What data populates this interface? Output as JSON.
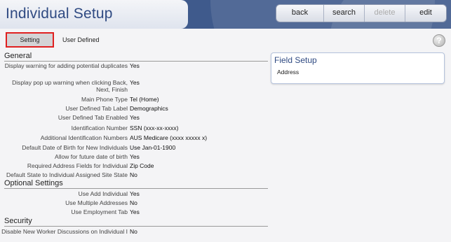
{
  "page": {
    "title": "Individual Setup"
  },
  "toolbar": {
    "back": "back",
    "search": "search",
    "delete": "delete",
    "edit": "edit"
  },
  "tabs": {
    "setting": "Setting",
    "user_defined": "User Defined"
  },
  "help_icon": "question-mark-icon",
  "general": {
    "heading": "General",
    "rows": [
      {
        "label": "Display warning for adding potential duplicates",
        "value": "Yes"
      },
      {
        "label": "Display pop up warning when clicking Back, Next, Finish",
        "value": "Yes"
      },
      {
        "label": "Main Phone Type",
        "value": "Tel (Home)"
      },
      {
        "label": "User Defined Tab Label",
        "value": "Demographics"
      },
      {
        "label": "User Defined Tab Enabled",
        "value": "Yes"
      },
      {
        "label": "Identification Number",
        "value": "SSN (xxx-xx-xxxx)"
      },
      {
        "label": "Additional Identification Numbers",
        "value": "AUS Medicare (xxxx xxxxx x)"
      },
      {
        "label": "Default Date of Birth for New Individuals",
        "value": "Use Jan-01-1900"
      },
      {
        "label": "Allow for future date of birth",
        "value": "Yes"
      },
      {
        "label": "Required Address Fields for Individual",
        "value": "Zip Code"
      },
      {
        "label": "Default State to Individual Assigned Site State",
        "value": "No"
      }
    ]
  },
  "optional": {
    "heading": "Optional Settings",
    "rows": [
      {
        "label": "Use Add Individual",
        "value": "Yes"
      },
      {
        "label": "Use Multiple Addresses",
        "value": "No"
      },
      {
        "label": "Use Employment Tab",
        "value": "Yes"
      }
    ]
  },
  "security": {
    "heading": "Security",
    "rows": [
      {
        "label": "Disable New Worker Discussions on Individual I",
        "value": "No"
      }
    ]
  },
  "field_setup": {
    "title": "Field Setup",
    "item": "Address"
  }
}
